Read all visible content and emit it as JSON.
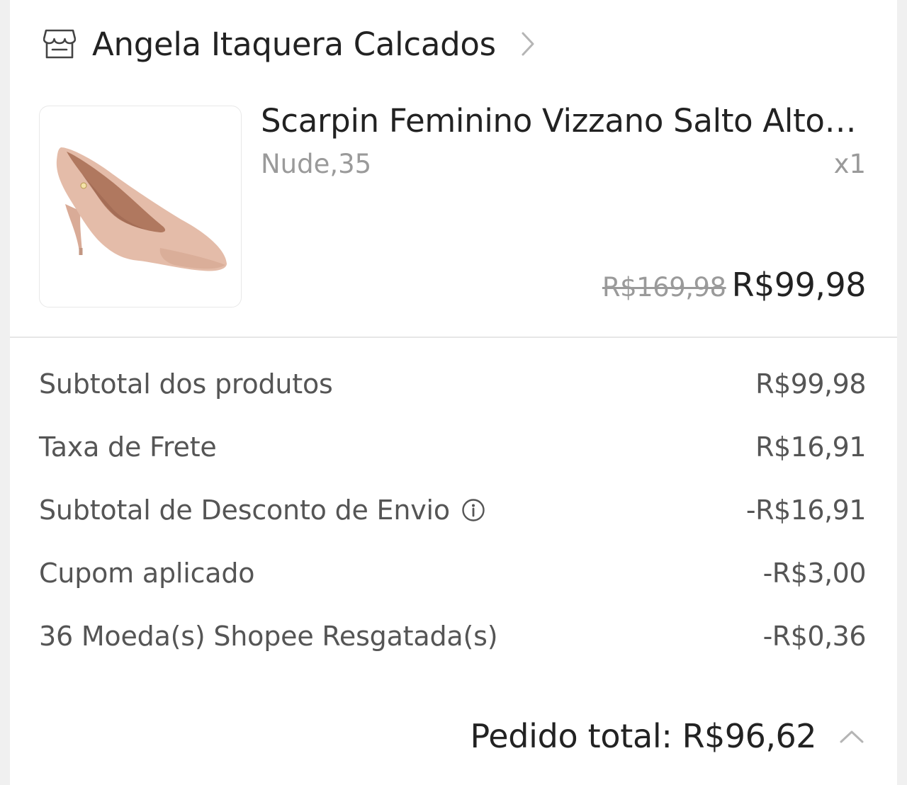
{
  "shop": {
    "name": "Angela Itaquera Calcados",
    "icon": "store-icon",
    "chevron_icon": "chevron-right-icon"
  },
  "product": {
    "name": "Scarpin Feminino Vizzano Salto Alto…",
    "variant": "Nude,35",
    "quantity": "x1",
    "price_original": "R$169,98",
    "price_current": "R$99,98",
    "image_color": "#e2b9a6"
  },
  "summary": {
    "rows": [
      {
        "label": "Subtotal dos produtos",
        "value": "R$99,98"
      },
      {
        "label": "Taxa de Frete",
        "value": "R$16,91"
      },
      {
        "label": "Subtotal de Desconto de Envio",
        "value": "-R$16,91",
        "icon": "info-icon"
      },
      {
        "label": "Cupom aplicado",
        "value": "-R$3,00"
      },
      {
        "label": "36 Moeda(s) Shopee Resgatada(s)",
        "value": "-R$0,36"
      }
    ]
  },
  "total": {
    "label": "Pedido total:",
    "value": "R$96,62",
    "icon": "chevron-up-icon"
  }
}
